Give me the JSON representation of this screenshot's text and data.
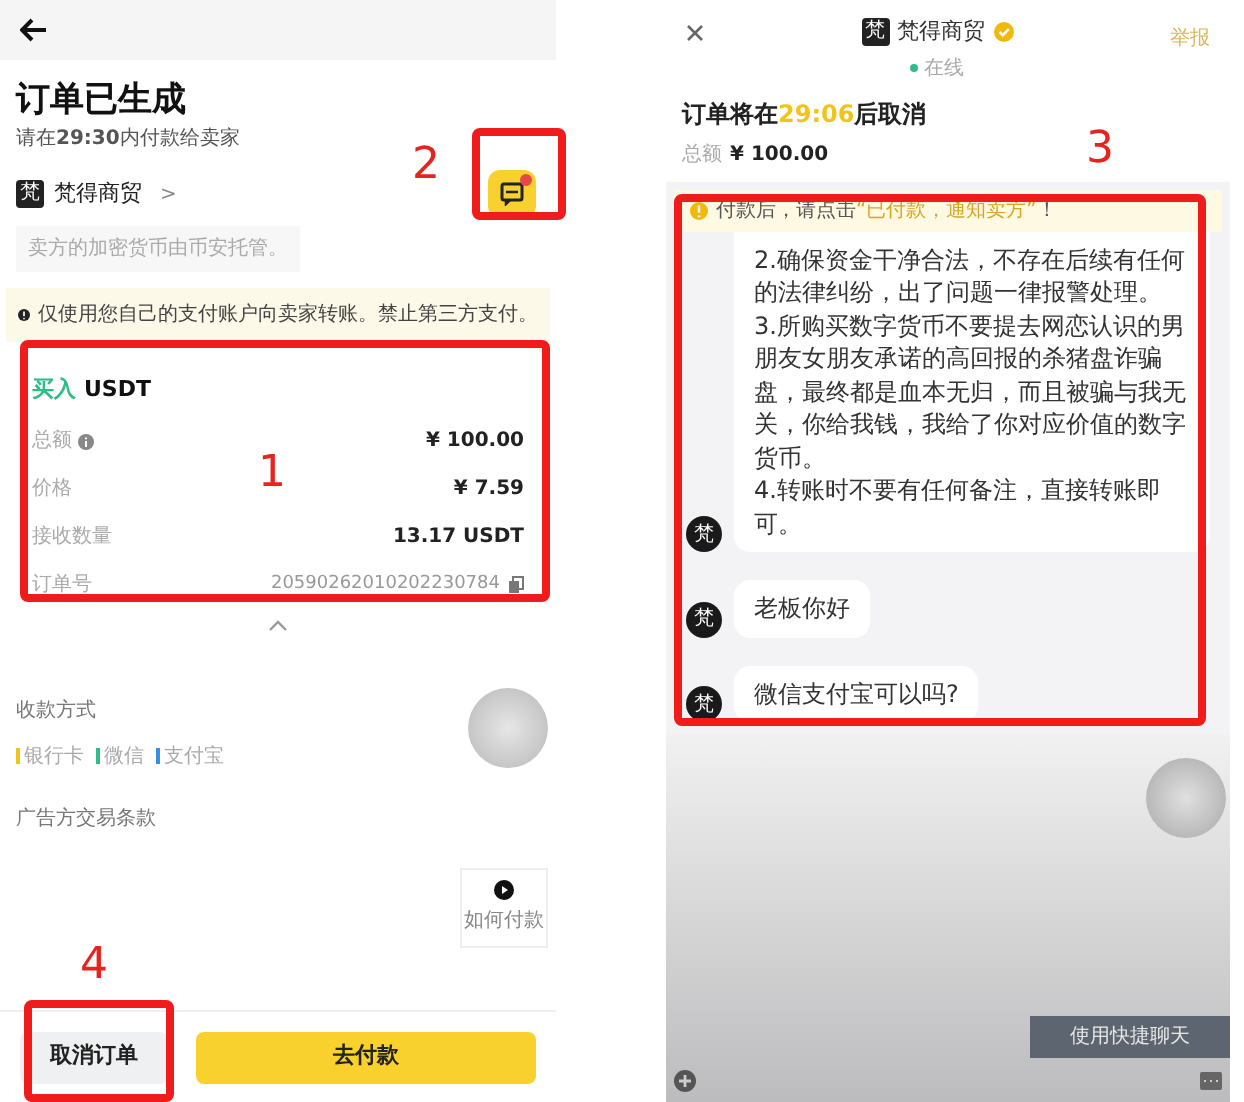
{
  "left_screen": {
    "title": "订单已生成",
    "subtitle": "请在**29:30**内付款给卖家",
    "merchant": {
      "logo": "梵",
      "name": "梵得商贸",
      "chevron": ">"
    },
    "merchant_note": "卖方的加密货币由币安托管。",
    "warning": "仅使用您自己的支付账户向卖家转账。禁止第三方支付。",
    "order": {
      "side": "买入",
      "asset": "USDT",
      "rows": [
        {
          "label": "总额",
          "value": "¥ 100.00",
          "kind": "info"
        },
        {
          "label": "价格",
          "value": "¥ 7.59",
          "kind": "plain"
        },
        {
          "label": "接收数量",
          "value": "13.17 USDT",
          "kind": "plain"
        },
        {
          "label": "订单号",
          "value": "20590262010202230784",
          "kind": "copy"
        }
      ]
    },
    "payment_title": "收款方式",
    "payment_methods": [
      {
        "label": "银行卡",
        "color": "#f0c419"
      },
      {
        "label": "微信",
        "color": "#2ebd85"
      },
      {
        "label": "支付宝",
        "color": "#3b8fe0"
      }
    ],
    "terms_title": "广告方交易条款",
    "video_tip": "如何付款",
    "chat_badge": true,
    "buttons": [
      {
        "label": "取消订单",
        "kind": "secondary"
      },
      {
        "label": "去付款",
        "kind": "primary"
      }
    ]
  },
  "right_screen": {
    "merchant": {
      "logo": "梵",
      "name": "梵得商贸",
      "verified": true
    },
    "status": "在线",
    "report": "举报",
    "countdown": {
      "prefix": "订单将在",
      "time": "29:06",
      "suffix": "后取消"
    },
    "total_label": "总额",
    "total_value": "¥ 100.00",
    "banner": {
      "prefix": "付款后，请点击",
      "highlight": "“已付款，通知卖方”",
      "suffix": "！"
    },
    "messages": [
      {
        "avatar": "梵",
        "lines": [
          "2.确保资金干净合法，不存在后续有任何的法律纠纷，出了问题一律报警处理。",
          "3.所购买数字货币不要提去网恋认识的男朋友女朋友承诺的高回报的杀猪盘诈骗盘，最终都是血本无归，而且被骗与我无关，你给我钱，我给了你对应价值的数字货币。",
          "4.转账时不要有任何备注，直接转账即可。"
        ]
      },
      {
        "avatar": "梵",
        "lines": [
          "老板你好"
        ]
      },
      {
        "avatar": "梵",
        "lines": [
          "微信支付宝可以吗?"
        ]
      }
    ],
    "quick_chat_tip": "使用快捷聊天"
  },
  "annotations": [
    "1",
    "2",
    "3",
    "4"
  ]
}
